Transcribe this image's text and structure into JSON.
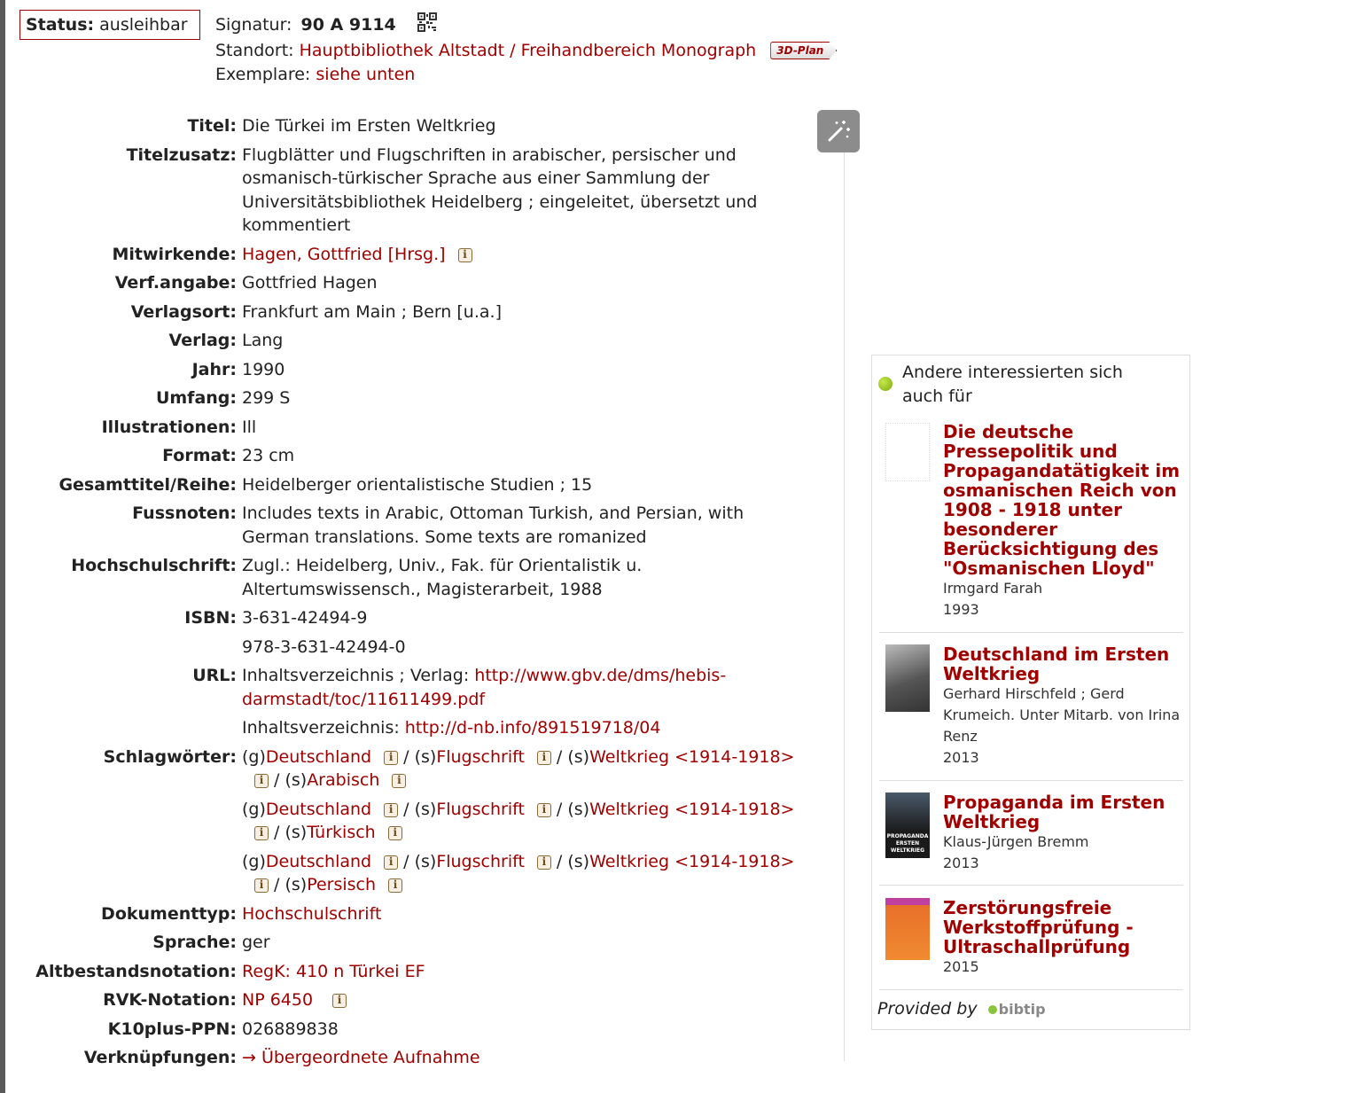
{
  "status": {
    "label": "Status:",
    "value": "ausleihbar"
  },
  "signatur": {
    "label": "Signatur:",
    "value": "90 A 9114"
  },
  "standort": {
    "label": "Standort:",
    "value": "Hauptbibliothek Altstadt / Freihandbereich Monograph",
    "plan_button": "3D-Plan"
  },
  "exemplare": {
    "label": "Exemplare:",
    "value": "siehe unten"
  },
  "details": {
    "titel": {
      "label": "Titel:",
      "value": "Die Türkei im Ersten Weltkrieg"
    },
    "titelzusatz": {
      "label": "Titelzusatz:",
      "value": "Flugblätter und Flugschriften in arabischer, persischer und osmanisch-türkischer Sprache aus einer Sammlung der Universitätsbibliothek Heidelberg ; eingeleitet, übersetzt und kommentiert"
    },
    "mitwirkende": {
      "label": "Mitwirkende:",
      "value": "Hagen, Gottfried [Hrsg.]"
    },
    "verfangabe": {
      "label": "Verf.angabe:",
      "value": "Gottfried Hagen"
    },
    "verlagsort": {
      "label": "Verlagsort:",
      "value": "Frankfurt am Main ; Bern [u.a.]"
    },
    "verlag": {
      "label": "Verlag:",
      "value": "Lang"
    },
    "jahr": {
      "label": "Jahr:",
      "value": "1990"
    },
    "umfang": {
      "label": "Umfang:",
      "value": "299 S"
    },
    "illustrationen": {
      "label": "Illustrationen:",
      "value": "Ill"
    },
    "format": {
      "label": "Format:",
      "value": "23 cm"
    },
    "reihe": {
      "label": "Gesamttitel/Reihe:",
      "value": "Heidelberger orientalistische Studien ; 15"
    },
    "fussnoten": {
      "label": "Fussnoten:",
      "value": "Includes texts in Arabic, Ottoman Turkish, and Persian, with German translations. Some texts are romanized"
    },
    "hochschulschrift": {
      "label": "Hochschulschrift:",
      "value": "Zugl.: Heidelberg, Univ., Fak. für Orientalistik u. Altertumswissensch., Magisterarbeit, 1988"
    },
    "isbn": {
      "label": "ISBN:",
      "values": [
        "3-631-42494-9",
        "978-3-631-42494-0"
      ]
    },
    "url": {
      "label": "URL:",
      "entries": [
        {
          "prefix": "Inhaltsverzeichnis ; Verlag: ",
          "link": "http://www.gbv.de/dms/hebis-darmstadt/toc/11611499.pdf"
        },
        {
          "prefix": "Inhaltsverzeichnis: ",
          "link": "http://d-nb.info/891519718/04"
        }
      ]
    },
    "schlagwoerter": {
      "label": "Schlagwörter:",
      "chains": [
        {
          "p1": "(g)",
          "t1": "Deutschland",
          "p2": "(s)",
          "t2": "Flugschrift",
          "p3": "(s)",
          "t3": "Weltkrieg <1914-1918>",
          "p4": "(s)",
          "t4": "Arabisch"
        },
        {
          "p1": "(g)",
          "t1": "Deutschland",
          "p2": "(s)",
          "t2": "Flugschrift",
          "p3": "(s)",
          "t3": "Weltkrieg <1914-1918>",
          "p4": "(s)",
          "t4": "Türkisch"
        },
        {
          "p1": "(g)",
          "t1": "Deutschland",
          "p2": "(s)",
          "t2": "Flugschrift",
          "p3": "(s)",
          "t3": "Weltkrieg <1914-1918>",
          "p4": "(s)",
          "t4": "Persisch"
        }
      ],
      "separator": "/"
    },
    "dokumenttyp": {
      "label": "Dokumenttyp:",
      "value": "Hochschulschrift"
    },
    "sprache": {
      "label": "Sprache:",
      "value": "ger"
    },
    "altbestand": {
      "label": "Altbestandsnotation:",
      "value": "RegK: 410 n Türkei EF"
    },
    "rvk": {
      "label": "RVK-Notation:",
      "value": "NP 6450"
    },
    "ppn": {
      "label": "K10plus-PPN:",
      "value": "026889838"
    },
    "verknuepfungen": {
      "label": "Verknüpfungen:",
      "arrow": "→",
      "value": "Übergeordnete Aufnahme"
    }
  },
  "recommendations": {
    "heading": "Andere interessierten sich auch für",
    "items": [
      {
        "title": "Die deutsche Pressepolitik und Propagandatätigkeit im osmanischen Reich von 1908 - 1918 unter besonderer Berücksichtigung des \"Osmanischen Lloyd\"",
        "author": "Irmgard Farah",
        "year": "1993"
      },
      {
        "title": "Deutschland im Ersten Weltkrieg",
        "author": "Gerhard Hirschfeld ; Gerd Krumeich. Unter Mitarb. von Irina Renz",
        "year": "2013"
      },
      {
        "title": "Propaganda im Ersten Weltkrieg",
        "author": "Klaus-Jürgen Bremm",
        "year": "2013",
        "cover_text": "PROPAGANDA ERSTEN WELTKRIEG"
      },
      {
        "title": "Zerstörungsfreie Werkstoffprüfung - Ultraschallprüfung",
        "author": "",
        "year": "2015"
      }
    ],
    "provided_by": "Provided by",
    "provider": "bibtip"
  }
}
